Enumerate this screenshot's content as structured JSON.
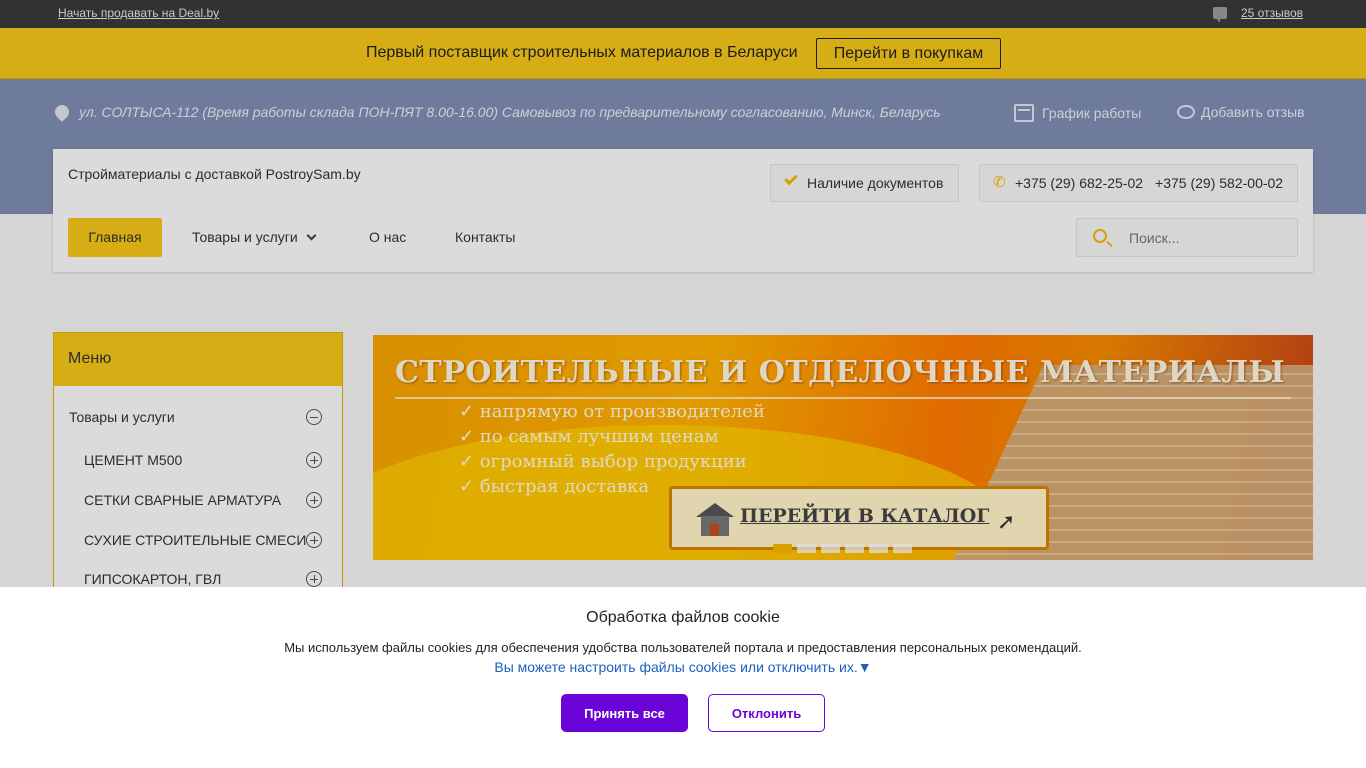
{
  "topbar": {
    "sell_link": "Начать продавать на Deal.by",
    "reviews_link": "25 отзывов",
    "reviews_icon": "comment-icon"
  },
  "promo": {
    "text": "Первый поставщик строительных материалов в Беларуси",
    "button": "Перейти в покупкам",
    "color": "#f5c518"
  },
  "header": {
    "address": "ул. СОЛТЫСА-112 (Время работы склада ПОН-ПЯТ 8.00-16.00) Самовывоз по предварительному согласованию, Минск, Беларусь",
    "schedule_link": "График работы",
    "add_review_link": "Добавить отзыв",
    "shop_name": "Стройматериалы с доставкой PostroySam.by",
    "docs_badge": "Наличие документов",
    "phone1": "+375 (29) 682-25-02",
    "phone2": "+375 (29) 582-00-02"
  },
  "nav": {
    "home": "Главная",
    "goods": "Товары и услуги",
    "about": "О нас",
    "contacts": "Контакты",
    "search_placeholder": "Поиск..."
  },
  "menu": {
    "title": "Меню",
    "items": [
      {
        "label": "Товары и услуги",
        "state": "expanded"
      },
      {
        "label": "ЦЕМЕНТ М500",
        "state": "collapsed"
      },
      {
        "label": "СЕТКИ СВАРНЫЕ АРМАТУРА",
        "state": "collapsed"
      },
      {
        "label": "СУХИЕ СТРОИТЕЛЬНЫЕ СМЕСИ",
        "state": "collapsed"
      },
      {
        "label": "ГИПСОКАРТОН, ГВЛ",
        "state": "collapsed"
      }
    ]
  },
  "banner": {
    "title": "СТРОИТЕЛЬНЫЕ И ОТДЕЛОЧНЫЕ МАТЕРИАЛЫ",
    "bullets": [
      "✓ напрямую от производителей",
      "✓ по самым лучшим ценам",
      "✓ огромный выбор продукции",
      "✓ быстрая доставка"
    ],
    "cta": "ПЕРЕЙТИ В КАТАЛОГ",
    "slides": 6,
    "active_slide": 1
  },
  "cookie": {
    "title": "Обработка файлов cookie",
    "text": "Мы используем файлы cookies для обеспечения удобства пользователей портала и предоставления персональных рекомендаций.",
    "settings_link": "Вы можете настроить файлы cookies или отключить их.▼",
    "accept": "Принять все",
    "decline": "Отклонить",
    "accent": "#6a04d9"
  }
}
